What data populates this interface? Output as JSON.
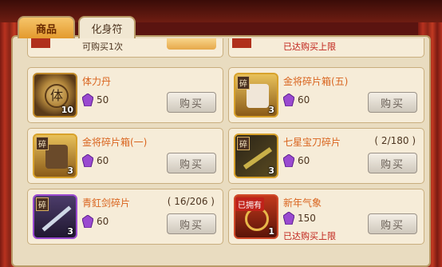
{
  "tabs": [
    {
      "label": "商品",
      "active": true
    },
    {
      "label": "化身符",
      "active": false
    }
  ],
  "top_row": {
    "left_text": "可购买1次",
    "right_text": "已达购买上限"
  },
  "items": [
    {
      "name": "体力丹",
      "count": "",
      "price": "50",
      "qty": "10",
      "limit": "",
      "badge": "",
      "icon": "stamina-pill-icon",
      "buy_label": "购买"
    },
    {
      "name": "金将碎片箱(五)",
      "count": "",
      "price": "60",
      "qty": "3",
      "limit": "",
      "badge": "碎",
      "icon": "fragment-box-icon",
      "buy_label": "购买"
    },
    {
      "name": "金将碎片箱(一)",
      "count": "",
      "price": "60",
      "qty": "3",
      "limit": "",
      "badge": "碎",
      "icon": "fragment-box-icon",
      "buy_label": "购买"
    },
    {
      "name": "七星宝刀碎片",
      "count": "( 2/180 )",
      "price": "60",
      "qty": "3",
      "limit": "",
      "badge": "碎",
      "icon": "saber-fragment-icon",
      "buy_label": "购买"
    },
    {
      "name": "青釭剑碎片",
      "count": "( 16/206 )",
      "price": "60",
      "qty": "3",
      "limit": "",
      "badge": "碎",
      "icon": "sword-fragment-icon",
      "buy_label": "购买"
    },
    {
      "name": "新年气象",
      "count": "",
      "price": "150",
      "qty": "1",
      "limit": "已达购买上限",
      "badge": "已拥有",
      "icon": "new-year-avatar-icon",
      "buy_label": "购买"
    }
  ],
  "colors": {
    "name": "#d9641e",
    "limit": "#c0221a",
    "gem": "#9a4ad0"
  }
}
